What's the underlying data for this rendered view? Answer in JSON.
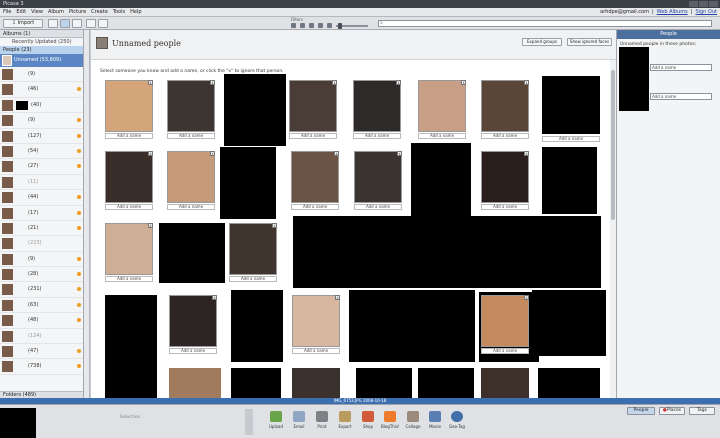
{
  "window": {
    "title": "Picasa 3"
  },
  "menu": [
    "File",
    "Edit",
    "View",
    "Album",
    "Picture",
    "Create",
    "Tools",
    "Help"
  ],
  "account": {
    "email": "arhdpe@gmail.com",
    "web_albums": "Web Albums",
    "sign_out": "Sign Out"
  },
  "toolbar": {
    "import_label": "Import",
    "filters_label": "Filters"
  },
  "sidebar": {
    "albums_header": "Albums (1)",
    "recently_updated": "Recently Updated (250)",
    "people_header": "People (23)",
    "unnamed_label": "Unnamed (53,809)",
    "people_counts": [
      "(9)",
      "(46)",
      "(40)",
      "(9)",
      "(127)",
      "(54)",
      "(27)",
      "(11)",
      "(44)",
      "(17)",
      "(21)",
      "(223)",
      "(9)",
      "(28)",
      "(231)",
      "(63)",
      "(48)",
      "(124)",
      "(47)",
      "(738)"
    ],
    "folders_header": "Folders (489)"
  },
  "main": {
    "title": "Unnamed people",
    "expand_groups": "Expand groups",
    "show_ignored": "Show ignored faces",
    "instructions": "Select someone you know and add a name, or click the \"x\" to ignore that person.",
    "add_name_label": "Add a name"
  },
  "status_strip": {
    "filename": "IMG_6753.JPG",
    "date": "2008-10-18"
  },
  "right_panel": {
    "header": "People",
    "subtitle": "Unnamed people in these photos:",
    "field_placeholder": "Add a name"
  },
  "bottom": {
    "selection_label": "Selection",
    "tools": [
      "Upload",
      "Email",
      "Print",
      "Export",
      "Shop",
      "BlogThis!",
      "Collage",
      "Movie",
      "Geo-Tag"
    ],
    "tabs": [
      "People",
      "Places",
      "Tags"
    ]
  },
  "colors": {
    "accent": "#5b86c4",
    "status_dot": "#f09a1f",
    "strip": "#3c6fb0"
  }
}
